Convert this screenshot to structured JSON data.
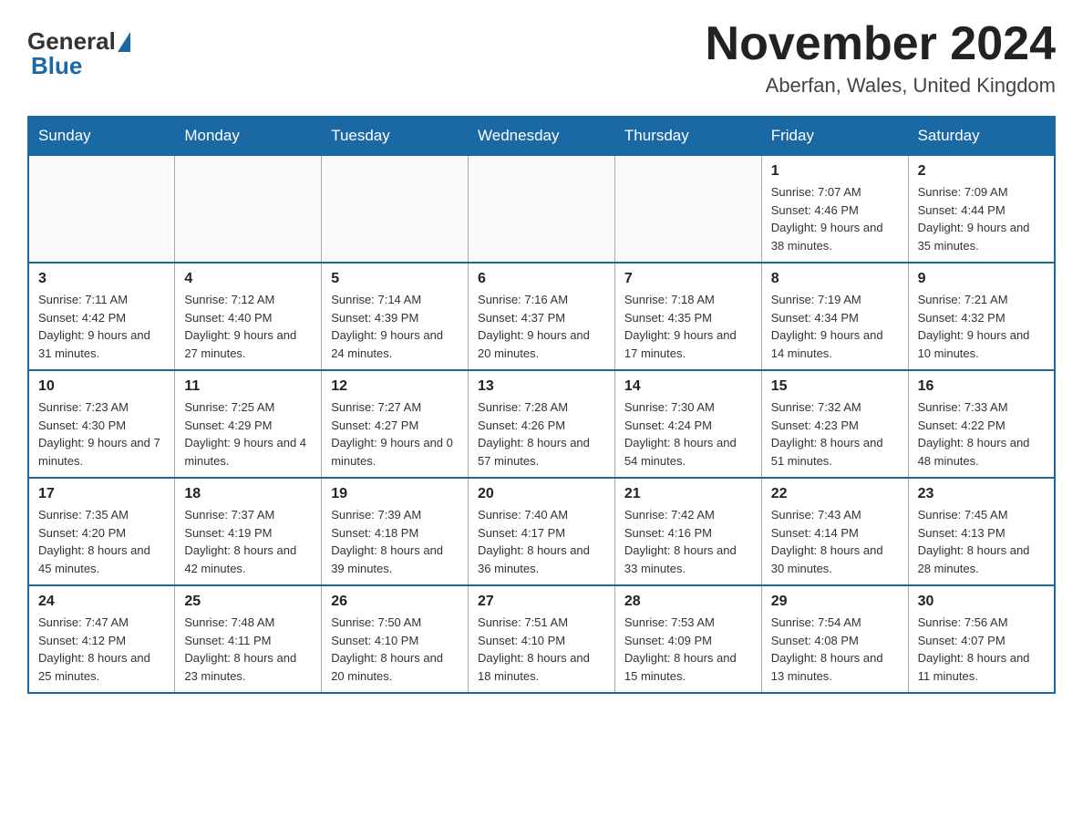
{
  "header": {
    "logo": {
      "general": "General",
      "blue": "Blue"
    },
    "title": "November 2024",
    "location": "Aberfan, Wales, United Kingdom"
  },
  "weekdays": [
    "Sunday",
    "Monday",
    "Tuesday",
    "Wednesday",
    "Thursday",
    "Friday",
    "Saturday"
  ],
  "weeks": [
    [
      {
        "day": "",
        "info": ""
      },
      {
        "day": "",
        "info": ""
      },
      {
        "day": "",
        "info": ""
      },
      {
        "day": "",
        "info": ""
      },
      {
        "day": "",
        "info": ""
      },
      {
        "day": "1",
        "info": "Sunrise: 7:07 AM\nSunset: 4:46 PM\nDaylight: 9 hours and 38 minutes."
      },
      {
        "day": "2",
        "info": "Sunrise: 7:09 AM\nSunset: 4:44 PM\nDaylight: 9 hours and 35 minutes."
      }
    ],
    [
      {
        "day": "3",
        "info": "Sunrise: 7:11 AM\nSunset: 4:42 PM\nDaylight: 9 hours and 31 minutes."
      },
      {
        "day": "4",
        "info": "Sunrise: 7:12 AM\nSunset: 4:40 PM\nDaylight: 9 hours and 27 minutes."
      },
      {
        "day": "5",
        "info": "Sunrise: 7:14 AM\nSunset: 4:39 PM\nDaylight: 9 hours and 24 minutes."
      },
      {
        "day": "6",
        "info": "Sunrise: 7:16 AM\nSunset: 4:37 PM\nDaylight: 9 hours and 20 minutes."
      },
      {
        "day": "7",
        "info": "Sunrise: 7:18 AM\nSunset: 4:35 PM\nDaylight: 9 hours and 17 minutes."
      },
      {
        "day": "8",
        "info": "Sunrise: 7:19 AM\nSunset: 4:34 PM\nDaylight: 9 hours and 14 minutes."
      },
      {
        "day": "9",
        "info": "Sunrise: 7:21 AM\nSunset: 4:32 PM\nDaylight: 9 hours and 10 minutes."
      }
    ],
    [
      {
        "day": "10",
        "info": "Sunrise: 7:23 AM\nSunset: 4:30 PM\nDaylight: 9 hours and 7 minutes."
      },
      {
        "day": "11",
        "info": "Sunrise: 7:25 AM\nSunset: 4:29 PM\nDaylight: 9 hours and 4 minutes."
      },
      {
        "day": "12",
        "info": "Sunrise: 7:27 AM\nSunset: 4:27 PM\nDaylight: 9 hours and 0 minutes."
      },
      {
        "day": "13",
        "info": "Sunrise: 7:28 AM\nSunset: 4:26 PM\nDaylight: 8 hours and 57 minutes."
      },
      {
        "day": "14",
        "info": "Sunrise: 7:30 AM\nSunset: 4:24 PM\nDaylight: 8 hours and 54 minutes."
      },
      {
        "day": "15",
        "info": "Sunrise: 7:32 AM\nSunset: 4:23 PM\nDaylight: 8 hours and 51 minutes."
      },
      {
        "day": "16",
        "info": "Sunrise: 7:33 AM\nSunset: 4:22 PM\nDaylight: 8 hours and 48 minutes."
      }
    ],
    [
      {
        "day": "17",
        "info": "Sunrise: 7:35 AM\nSunset: 4:20 PM\nDaylight: 8 hours and 45 minutes."
      },
      {
        "day": "18",
        "info": "Sunrise: 7:37 AM\nSunset: 4:19 PM\nDaylight: 8 hours and 42 minutes."
      },
      {
        "day": "19",
        "info": "Sunrise: 7:39 AM\nSunset: 4:18 PM\nDaylight: 8 hours and 39 minutes."
      },
      {
        "day": "20",
        "info": "Sunrise: 7:40 AM\nSunset: 4:17 PM\nDaylight: 8 hours and 36 minutes."
      },
      {
        "day": "21",
        "info": "Sunrise: 7:42 AM\nSunset: 4:16 PM\nDaylight: 8 hours and 33 minutes."
      },
      {
        "day": "22",
        "info": "Sunrise: 7:43 AM\nSunset: 4:14 PM\nDaylight: 8 hours and 30 minutes."
      },
      {
        "day": "23",
        "info": "Sunrise: 7:45 AM\nSunset: 4:13 PM\nDaylight: 8 hours and 28 minutes."
      }
    ],
    [
      {
        "day": "24",
        "info": "Sunrise: 7:47 AM\nSunset: 4:12 PM\nDaylight: 8 hours and 25 minutes."
      },
      {
        "day": "25",
        "info": "Sunrise: 7:48 AM\nSunset: 4:11 PM\nDaylight: 8 hours and 23 minutes."
      },
      {
        "day": "26",
        "info": "Sunrise: 7:50 AM\nSunset: 4:10 PM\nDaylight: 8 hours and 20 minutes."
      },
      {
        "day": "27",
        "info": "Sunrise: 7:51 AM\nSunset: 4:10 PM\nDaylight: 8 hours and 18 minutes."
      },
      {
        "day": "28",
        "info": "Sunrise: 7:53 AM\nSunset: 4:09 PM\nDaylight: 8 hours and 15 minutes."
      },
      {
        "day": "29",
        "info": "Sunrise: 7:54 AM\nSunset: 4:08 PM\nDaylight: 8 hours and 13 minutes."
      },
      {
        "day": "30",
        "info": "Sunrise: 7:56 AM\nSunset: 4:07 PM\nDaylight: 8 hours and 11 minutes."
      }
    ]
  ]
}
